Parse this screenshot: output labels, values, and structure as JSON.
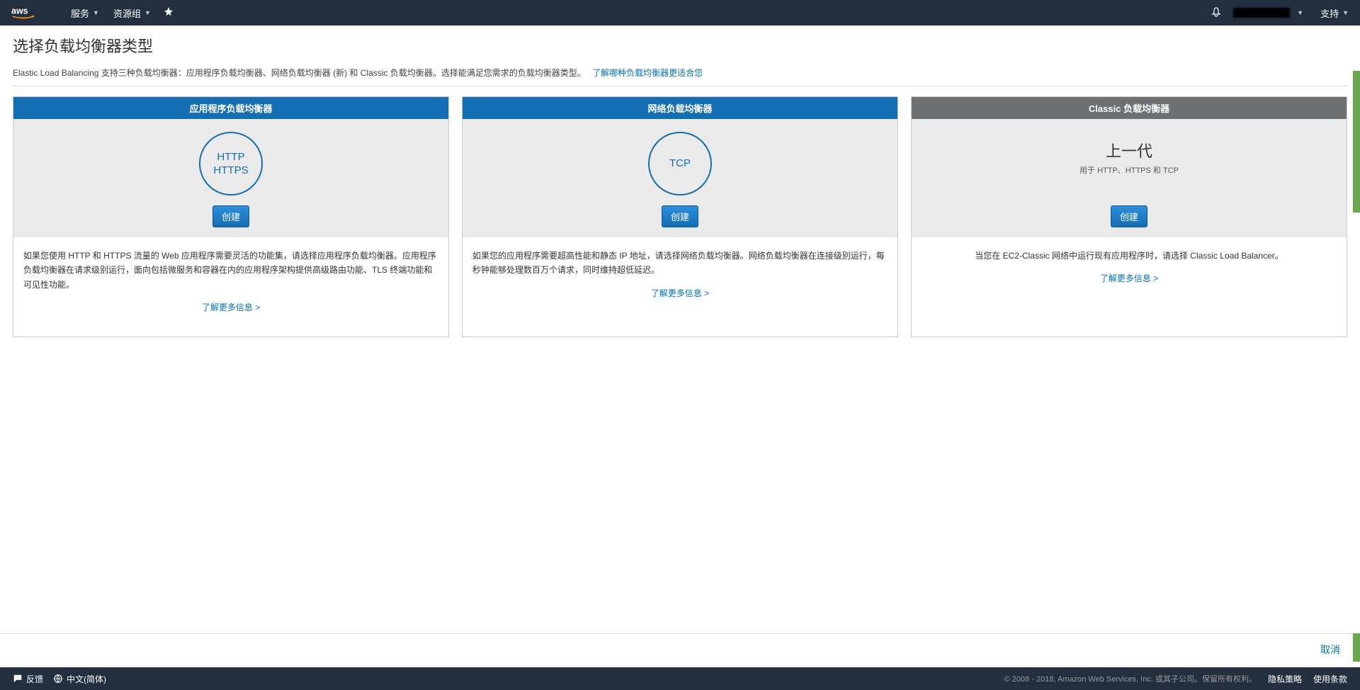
{
  "nav": {
    "services": "服务",
    "resource_groups": "资源组",
    "support": "支持"
  },
  "page": {
    "title": "选择负载均衡器类型",
    "description": "Elastic Load Balancing 支持三种负载均衡器：应用程序负载均衡器、网络负载均衡器 (新) 和 Classic 负载均衡器。选择能满足您需求的负载均衡器类型。",
    "desc_link": "了解哪种负载均衡器更适合您"
  },
  "cards": [
    {
      "title": "应用程序负载均衡器",
      "circle_lines": [
        "HTTP",
        "HTTPS"
      ],
      "create": "创建",
      "body": "如果您使用 HTTP 和 HTTPS 流量的 Web 应用程序需要灵活的功能集，请选择应用程序负载均衡器。应用程序负载均衡器在请求级别运行，面向包括微服务和容器在内的应用程序架构提供高级路由功能、TLS 终端功能和可见性功能。",
      "learn_more": "了解更多信息 >"
    },
    {
      "title": "网络负载均衡器",
      "circle_lines": [
        "TCP"
      ],
      "create": "创建",
      "body": "如果您的应用程序需要超高性能和静态 IP 地址，请选择网络负载均衡器。网络负载均衡器在连接级别运行，每秒钟能够处理数百万个请求，同时维持超低延迟。",
      "learn_more": "了解更多信息 >"
    },
    {
      "title": "Classic 负载均衡器",
      "prev_title": "上一代",
      "prev_sub": "用于 HTTP、HTTPS 和 TCP",
      "create": "创建",
      "body": "当您在 EC2-Classic 网络中运行现有应用程序时，请选择 Classic Load Balancer。",
      "learn_more": "了解更多信息 >"
    }
  ],
  "cancel": "取消",
  "footer": {
    "feedback": "反馈",
    "language": "中文(简体)",
    "copyright": "© 2008 - 2018, Amazon Web Services, Inc. 或其子公司。保留所有权利。",
    "privacy": "隐私策略",
    "terms": "使用条款"
  }
}
